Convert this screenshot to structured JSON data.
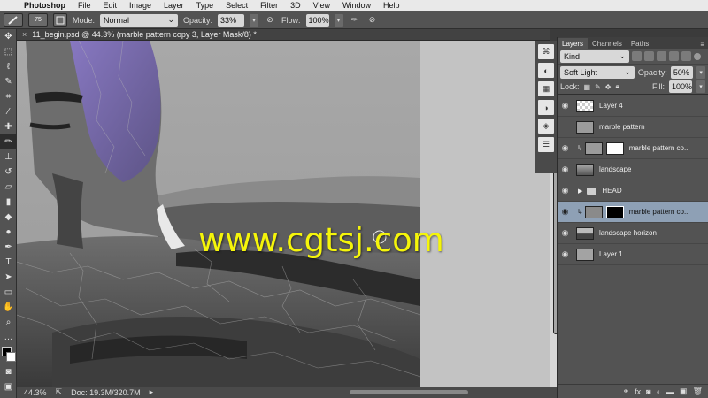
{
  "menubar": {
    "apple": "",
    "app_name": "Photoshop",
    "items": [
      "File",
      "Edit",
      "Image",
      "Layer",
      "Type",
      "Select",
      "Filter",
      "3D",
      "View",
      "Window",
      "Help"
    ]
  },
  "options": {
    "brush_size": "75",
    "mode_label": "Mode:",
    "mode_value": "Normal",
    "opacity_label": "Opacity:",
    "opacity_value": "33%",
    "flow_label": "Flow:",
    "flow_value": "100%"
  },
  "document": {
    "tab_title": "11_begin.psd @ 44.3% (marble pattern copy 3, Layer Mask/8) *",
    "close": "×",
    "watermark": "www.cgtsj.com"
  },
  "status": {
    "zoom": "44.3%",
    "doc": "Doc: 19.3M/320.7M"
  },
  "layers_panel": {
    "tabs": [
      "Layers",
      "Channels",
      "Paths"
    ],
    "filter": "Kind",
    "blend_mode": "Soft Light",
    "opacity_label": "Opacity:",
    "opacity_value": "50%",
    "lock_label": "Lock:",
    "fill_label": "Fill:",
    "fill_value": "100%",
    "layers": [
      {
        "name": "Layer 4",
        "visible": true
      },
      {
        "name": "marble pattern",
        "visible": false
      },
      {
        "name": "marble pattern co...",
        "visible": true
      },
      {
        "name": "landscape",
        "visible": true
      },
      {
        "name": "HEAD",
        "visible": true
      },
      {
        "name": "marble pattern co...",
        "visible": true
      },
      {
        "name": "landscape horizon",
        "visible": true
      },
      {
        "name": "Layer 1",
        "visible": true
      }
    ]
  },
  "colors": {
    "selected_layer": "#8ea0b5",
    "watermark": "#f5f50a",
    "canvas_bg": "#c3c3c3"
  }
}
